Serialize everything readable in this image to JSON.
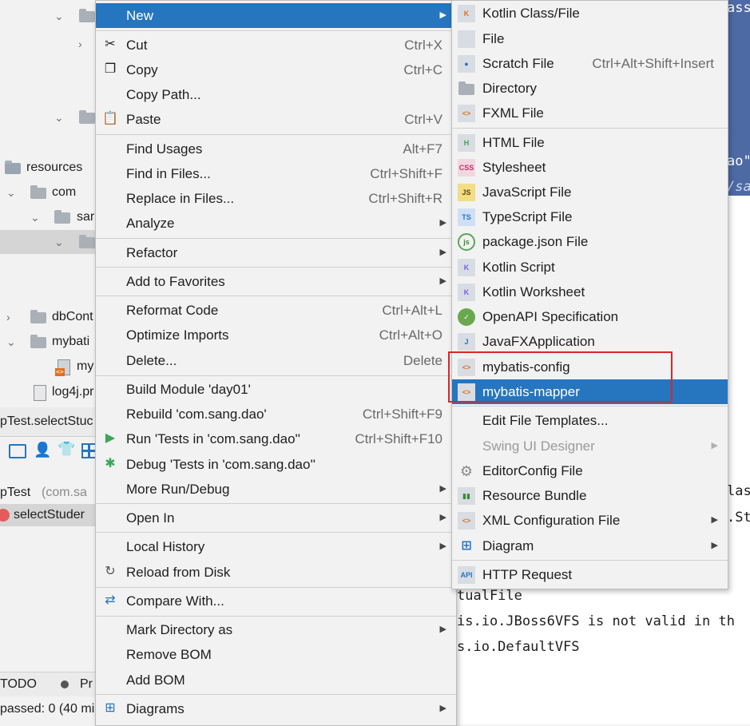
{
  "project_tree": {
    "items": [
      {
        "label": "resources"
      },
      {
        "label": "com"
      },
      {
        "label": "sar"
      },
      {
        "label": ""
      },
      {
        "label": "dbCont"
      },
      {
        "label": "mybati"
      },
      {
        "label": "my"
      },
      {
        "label": "log4j.pr"
      }
    ]
  },
  "run_panel": {
    "tab_label": "pTest.selectStuc",
    "test_class": "pTest",
    "test_class_pkg": "(com.sa",
    "test_method": "selectStuder",
    "status": "passed: 0 (40 mi",
    "todo_tab": "TODO",
    "problems_tab": "Pr"
  },
  "editor": {
    "lines": [
      {
        "text": "ass"
      },
      {
        "text": "ao\""
      },
      {
        "text": "/sa"
      },
      {
        "text": "las"
      },
      {
        "text": ".St"
      },
      {
        "text": "tualFile"
      },
      {
        "text": "is.io.JBoss6VFS is not valid in th"
      },
      {
        "text": "s.io.DefaultVFS"
      }
    ]
  },
  "main_menu": {
    "items": [
      {
        "label": "New",
        "shortcut": "",
        "submenu": true
      },
      {
        "label": "Cut",
        "shortcut": "Ctrl+X"
      },
      {
        "label": "Copy",
        "shortcut": "Ctrl+C"
      },
      {
        "label": "Copy Path...",
        "shortcut": ""
      },
      {
        "label": "Paste",
        "shortcut": "Ctrl+V"
      },
      {
        "label": "Find Usages",
        "shortcut": "Alt+F7"
      },
      {
        "label": "Find in Files...",
        "shortcut": "Ctrl+Shift+F"
      },
      {
        "label": "Replace in Files...",
        "shortcut": "Ctrl+Shift+R"
      },
      {
        "label": "Analyze",
        "shortcut": "",
        "submenu": true
      },
      {
        "label": "Refactor",
        "shortcut": "",
        "submenu": true
      },
      {
        "label": "Add to Favorites",
        "shortcut": "",
        "submenu": true
      },
      {
        "label": "Reformat Code",
        "shortcut": "Ctrl+Alt+L"
      },
      {
        "label": "Optimize Imports",
        "shortcut": "Ctrl+Alt+O"
      },
      {
        "label": "Delete...",
        "shortcut": "Delete"
      },
      {
        "label": "Build Module 'day01'",
        "shortcut": ""
      },
      {
        "label": "Rebuild 'com.sang.dao'",
        "shortcut": "Ctrl+Shift+F9"
      },
      {
        "label": "Run 'Tests in 'com.sang.dao''",
        "shortcut": "Ctrl+Shift+F10"
      },
      {
        "label": "Debug 'Tests in 'com.sang.dao''",
        "shortcut": ""
      },
      {
        "label": "More Run/Debug",
        "shortcut": "",
        "submenu": true
      },
      {
        "label": "Open In",
        "shortcut": "",
        "submenu": true
      },
      {
        "label": "Local History",
        "shortcut": "",
        "submenu": true
      },
      {
        "label": "Reload from Disk",
        "shortcut": ""
      },
      {
        "label": "Compare With...",
        "shortcut": ""
      },
      {
        "label": "Mark Directory as",
        "shortcut": "",
        "submenu": true
      },
      {
        "label": "Remove BOM",
        "shortcut": ""
      },
      {
        "label": "Add BOM",
        "shortcut": ""
      },
      {
        "label": "Diagrams",
        "shortcut": "",
        "submenu": true
      }
    ]
  },
  "new_submenu": {
    "items": [
      {
        "label": "Kotlin Class/File",
        "shortcut": ""
      },
      {
        "label": "File",
        "shortcut": ""
      },
      {
        "label": "Scratch File",
        "shortcut": "Ctrl+Alt+Shift+Insert"
      },
      {
        "label": "Directory",
        "shortcut": ""
      },
      {
        "label": "FXML File",
        "shortcut": ""
      },
      {
        "label": "HTML File",
        "shortcut": ""
      },
      {
        "label": "Stylesheet",
        "shortcut": ""
      },
      {
        "label": "JavaScript File",
        "shortcut": ""
      },
      {
        "label": "TypeScript File",
        "shortcut": ""
      },
      {
        "label": "package.json File",
        "shortcut": ""
      },
      {
        "label": "Kotlin Script",
        "shortcut": ""
      },
      {
        "label": "Kotlin Worksheet",
        "shortcut": ""
      },
      {
        "label": "OpenAPI Specification",
        "shortcut": ""
      },
      {
        "label": "JavaFXApplication",
        "shortcut": ""
      },
      {
        "label": "mybatis-config",
        "shortcut": ""
      },
      {
        "label": "mybatis-mapper",
        "shortcut": ""
      },
      {
        "label": "Edit File Templates...",
        "shortcut": ""
      },
      {
        "label": "Swing UI Designer",
        "shortcut": "",
        "submenu": true
      },
      {
        "label": "EditorConfig File",
        "shortcut": ""
      },
      {
        "label": "Resource Bundle",
        "shortcut": ""
      },
      {
        "label": "XML Configuration File",
        "shortcut": "",
        "submenu": true
      },
      {
        "label": "Diagram",
        "shortcut": "",
        "submenu": true
      },
      {
        "label": "HTTP Request",
        "shortcut": ""
      }
    ]
  },
  "colors": {
    "highlight": "#2675bf",
    "menu_bg": "#f2f2f2",
    "annotation_box": "#d9262b"
  }
}
